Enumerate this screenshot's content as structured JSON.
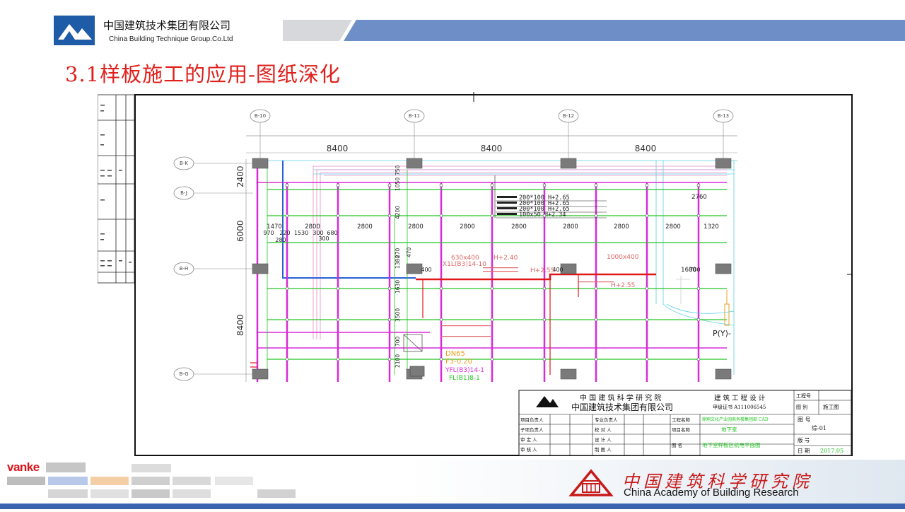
{
  "header": {
    "company_cn": "中国建筑技术集团有限公司",
    "company_en": "China Building Technique Group.Co.Ltd"
  },
  "slide": {
    "title": "3.1样板施工的应用-图纸深化"
  },
  "drawing": {
    "column_tags": [
      "B-10",
      "B-11",
      "B-12",
      "B-13"
    ],
    "row_tags": [
      "B-K",
      "B-J",
      "B-H",
      "B-G"
    ],
    "span_dims": [
      "8400",
      "8400",
      "8400"
    ],
    "left_dims": [
      "2400",
      "6000",
      "8400"
    ],
    "detail_dims": [
      "1470",
      "2800",
      "2800",
      "2800",
      "2800",
      "2800",
      "2800",
      "2800",
      "2800",
      "1320",
      "2760",
      "1680"
    ],
    "small_dims": [
      "970",
      "220",
      "1530",
      "300",
      "680",
      "280",
      "300",
      "400",
      "400",
      "700"
    ],
    "duct_notes": [
      "200*100  H+2.65",
      "200*100  H+2.65",
      "200*100  H+2.65",
      "100x50  H+2.34"
    ],
    "pipe_labels": [
      "630x400",
      "H+2.40",
      "X1L(B3)14-10",
      "1000x400",
      "H+2.55",
      "H+2.55",
      "DN65",
      "F3-0.20",
      "YFL(B3)14-1",
      "FL(B1)8-1",
      "P(Y)-"
    ],
    "vert_dims": [
      "750",
      "1050",
      "4200",
      "470",
      "1380",
      "1630",
      "3500",
      "700",
      "2100",
      "270"
    ]
  },
  "title_block": {
    "institute_line1": "中 国 建 筑 科 学 研 究 院",
    "institute_line2": "中国建筑技术集团有限公司",
    "design_label": "建 筑 工 程 设 计",
    "cert": "甲级证书 A111006545",
    "proj_no_label": "工程号",
    "cat_label": "图 别",
    "cat_value": "施工图",
    "drawing_no_label": "图 号",
    "drawing_no_value": "综-01",
    "version_label": "版 号",
    "date_label": "日 期",
    "date_value": "2017.05",
    "rows_left": [
      "项目负责人",
      "子项负责人",
      "审 定 人",
      "审 核 人"
    ],
    "rows_mid": [
      "专业负责人",
      "校 对 人",
      "设 计 人",
      "制 图 人"
    ],
    "project_label": "工程名称",
    "project_value": "鼎翔文化产业园商务楼集团部 CAD",
    "sub_label": "项目名称",
    "sub_value": "地下室",
    "name_label": "图    名",
    "name_value": "地下室样板区机电平面图"
  },
  "footer": {
    "brand": "vanke",
    "cabr_cn": "中国建筑科学研究院",
    "cabr_en": "China Academy of Building Research"
  },
  "colors": {
    "title_red": "#e0201c",
    "logo_blue": "#1e5ca8",
    "pipe_magenta": "#d82bd8",
    "pipe_green": "#24c424",
    "duct_red": "#e01818",
    "pipe_blue": "#2a5fd8"
  }
}
